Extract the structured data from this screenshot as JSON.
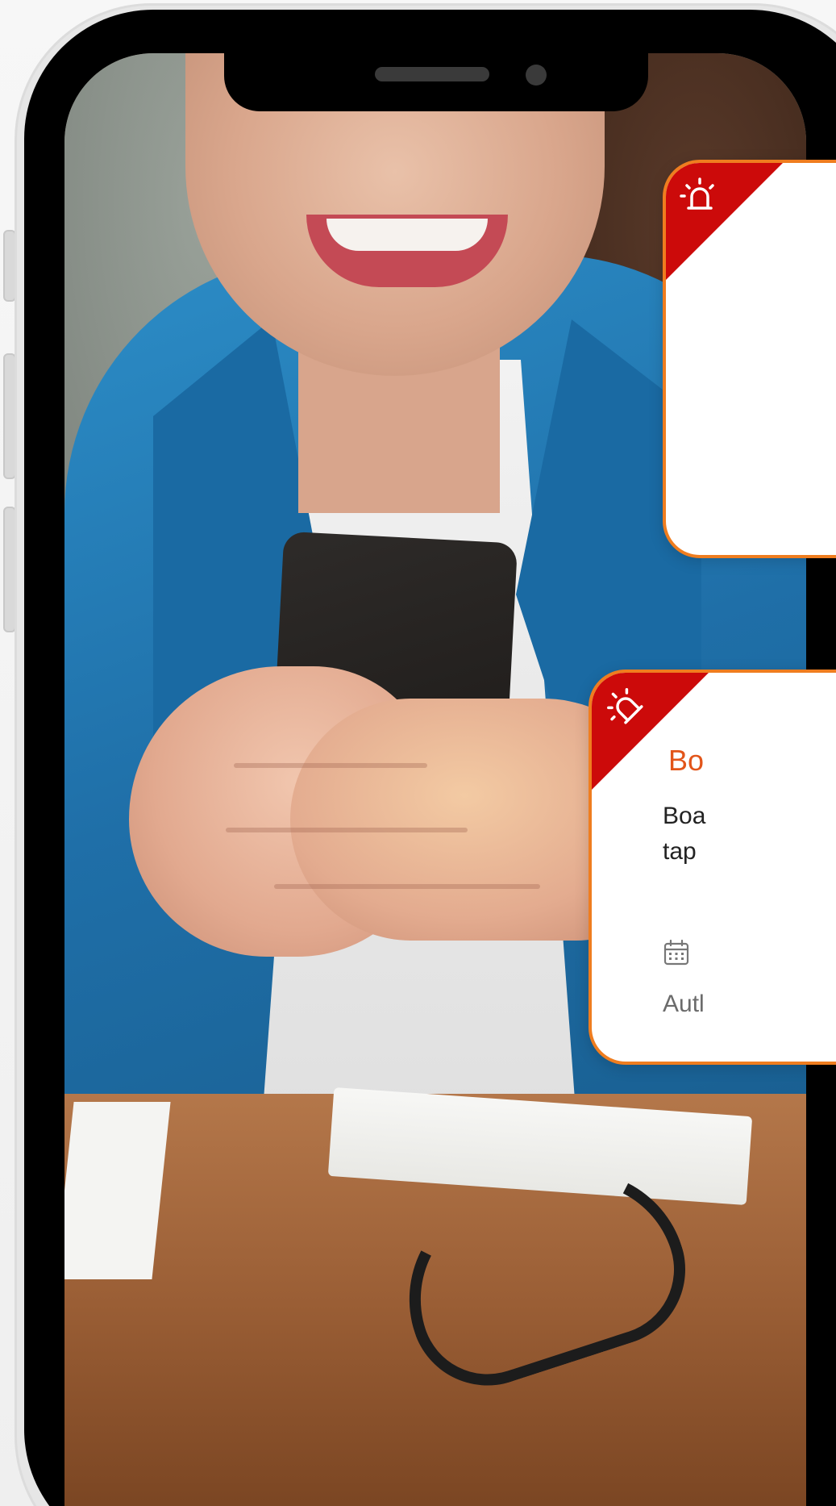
{
  "scene": {
    "description_colors": {
      "accent_orange": "#ef7d1f",
      "alert_red": "#cc0a0a",
      "title_orange": "#e2551a"
    }
  },
  "notifications": [
    {
      "icon": "alarm-siren-icon",
      "title": "",
      "body": "",
      "meta": ""
    },
    {
      "icon": "alarm-siren-icon",
      "title": "Bo",
      "body": "Boa\ntap",
      "date_icon": "calendar-icon",
      "meta": "Autl"
    }
  ]
}
